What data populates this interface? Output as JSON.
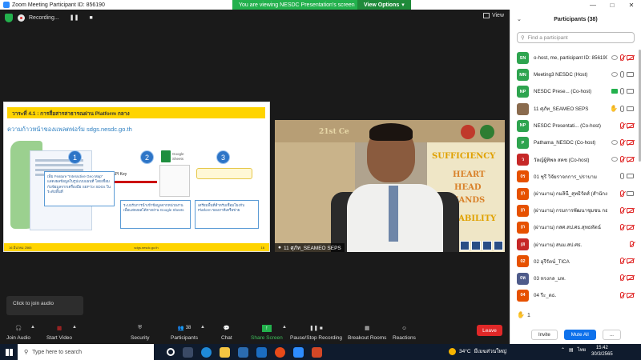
{
  "window": {
    "title": "Zoom Meeting Participant ID: 856190"
  },
  "topbar": {
    "recording_label": "Recording...",
    "viewing_banner": "You are viewing NESDC Presentation's screen",
    "view_options": "View Options",
    "view_button": "View"
  },
  "slide": {
    "header": "วาระที่ 4.1 : การสื่อสารสาธารณผ่าน Platform กลาง",
    "subtitle": "ความก้าวหน้าของแพลตฟอร์ม sdgs.nesdc.go.th",
    "step_numbers": [
      "1",
      "2",
      "3"
    ],
    "callout1": "เพิ่ม Feature \"Interactive Geo Map\" แสดงผลข้อมูลในรูปแบบแผนที่ โดยเชื่อมกับข้อมูลจากเครื่องมือ SEP for SDGs ในระดับพื้นที่",
    "callout2": "ระบบรับการนำเข้าข้อมูลจากหน่วยงานเพื่อแสดงผลได้ทางผ่าน Google Sheets",
    "callout3": "เตรียมพื้นที่สำหรับเชื่อมโยงกับ Platform ของภาคีเครือข่าย",
    "api_key_label": "Google API Key",
    "google_sheets_label_1": "Google",
    "google_sheets_label_2": "Sheets",
    "footer_left": "16 มีนาคม 2565",
    "footer_center": "sdgs.nesdc.go.th",
    "footer_right": "16"
  },
  "video": {
    "participant_name": "11 ศุภัท_SEAMEO SEPS",
    "words": [
      "SUFFICIENCY",
      "HEART",
      "HEAD",
      "HANDS",
      "NABILITY"
    ],
    "banner_text": "21st Ce"
  },
  "join_audio_tip": "Click to join audio",
  "toolbar": {
    "join_audio": "Join Audio",
    "start_video": "Start Video",
    "security": "Security",
    "participants": "Participants",
    "participants_count": "38",
    "chat": "Chat",
    "share_screen": "Share Screen",
    "pause_recording": "Pause/Stop Recording",
    "breakout_rooms": "Breakout Rooms",
    "reactions": "Reactions",
    "leave": "Leave"
  },
  "panel": {
    "title": "Participants (38)",
    "search_placeholder": "Find a participant",
    "participants": [
      {
        "initials": "SN",
        "name": "o-host, me, participant ID: 856190)",
        "color": "#2ea44f"
      },
      {
        "initials": "MN",
        "name": "Meeting3 NESDC (Host)",
        "color": "#2ea44f"
      },
      {
        "initials": "NP",
        "name": "NESDC Prese... (Co-host)",
        "color": "#2ea44f"
      },
      {
        "initials": "",
        "name": "11 ศุภัท_SEAMEO SEPS",
        "color": "#8a6b4e"
      },
      {
        "initials": "NP",
        "name": "NESDC Presentati... (Co-host)",
        "color": "#2ea44f"
      },
      {
        "initials": "P",
        "name": "Pathama_NESDC (Co-host)",
        "color": "#2ea44f"
      },
      {
        "initials": "ว",
        "name": "วัลญ์ผู้ทิพล สคช (Co-host)",
        "color": "#c62828"
      },
      {
        "initials": "0ร",
        "name": "01 ชุรี วิจัยราจกการ_ปราบาม",
        "color": "#e65100"
      },
      {
        "initials": "(ก",
        "name": "(ผ่านงาน) กมลินี_สุทธิรัตส์ (สำนักงาน...",
        "color": "#e65100"
      },
      {
        "initials": "(ก",
        "name": "(ผ่านงาน) กรมการพัฒนาชุมชน กองแ...",
        "color": "#e65100"
      },
      {
        "initials": "(ก",
        "name": "(ผ่านงาน) กสศ.สป.ศธ.สุทธทัตน์",
        "color": "#e65100"
      },
      {
        "initials": "(ส",
        "name": "(ผ่านงาน) สนม.สป.ศธ.",
        "color": "#c62828"
      },
      {
        "initials": "02",
        "name": "02 อุรีรัตน์_TICA",
        "color": "#e65100"
      },
      {
        "initials": "0ห",
        "name": "03 หรงกล_มท.",
        "color": "#4e5b8a"
      },
      {
        "initials": "04",
        "name": "04 รีะ_ดธ.",
        "color": "#e65100"
      }
    ],
    "reaction_count": "1",
    "invite": "Invite",
    "mute_all": "Mute All",
    "more": "..."
  },
  "taskbar": {
    "search_placeholder": "Type here to search",
    "temperature": "34°C",
    "weather_text": "มีเมฆส่วนใหญ่",
    "language": "ไทย",
    "time": "15:42",
    "date": "30/3/2565"
  }
}
